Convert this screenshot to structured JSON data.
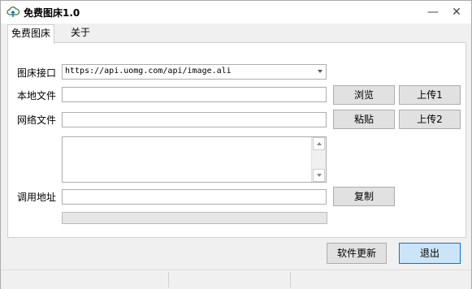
{
  "window": {
    "title": "免费图床1.0"
  },
  "titlebar": {
    "minimize": "—",
    "close": "✕"
  },
  "tabs": [
    {
      "label": "免费图床",
      "active": true
    },
    {
      "label": "关于",
      "active": false
    }
  ],
  "form": {
    "api_label": "图床接口",
    "api_value": "https://api.uomg.com/api/image.ali",
    "local_label": "本地文件",
    "local_value": "",
    "browse_button": "浏览",
    "upload1_button": "上传1",
    "web_label": "网络文件",
    "web_value": "",
    "paste_button": "粘贴",
    "upload2_button": "上传2",
    "log_text": "",
    "url_label": "调用地址",
    "url_value": "",
    "copy_button": "复制",
    "progress": 0
  },
  "footer": {
    "update_button": "软件更新",
    "exit_button": "退出"
  },
  "statusbar": {
    "cells": [
      "",
      "",
      ""
    ]
  },
  "colors": {
    "accent": "#0078d7",
    "exit_bg": "#cce4f7",
    "button_bg": "#e1e1e1"
  },
  "icons": {
    "app": "cloud-upload-icon"
  }
}
